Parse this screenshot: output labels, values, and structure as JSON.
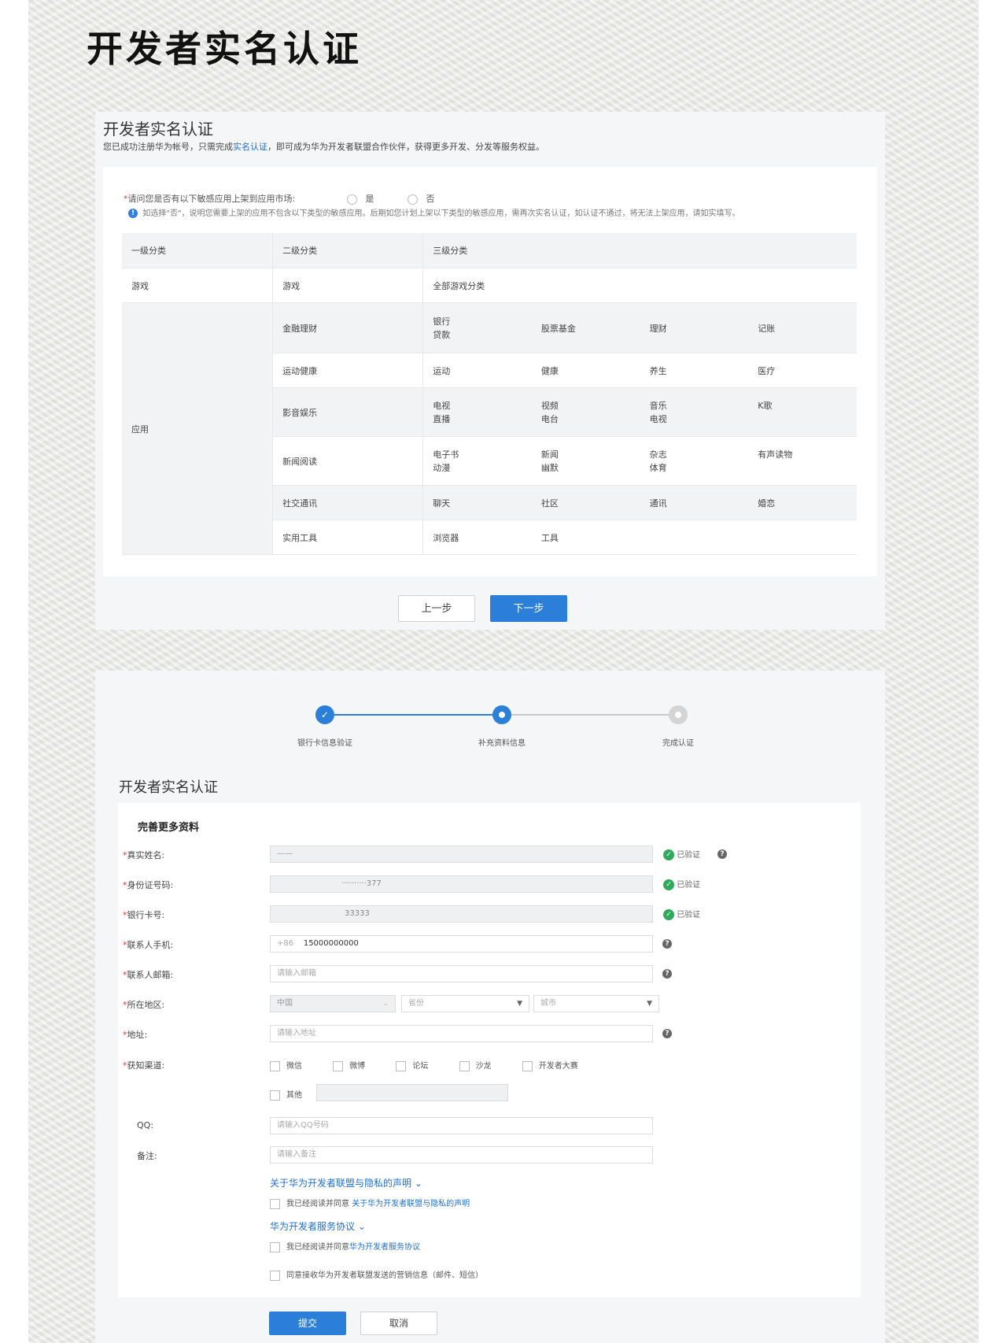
{
  "page_title": "开发者实名认证",
  "panel1": {
    "title": "开发者实名认证",
    "intro_before": "您已成功注册华为帐号，只需完成",
    "intro_link": "实名认证",
    "intro_after": "，即可成为华为开发者联盟合作伙伴，获得更多开发、分发等服务权益。",
    "question_required": "*",
    "question": "请问您是否有以下敏感应用上架到应用市场:",
    "option_yes": "是",
    "option_no": "否",
    "notice": "如选择\"否\"，说明您需要上架的应用不包含以下类型的敏感应用。后期如您计划上架以下类型的敏感应用，需再次实名认证，如认证不通过，将无法上架应用，请如实填写。",
    "table": {
      "headers": [
        "一级分类",
        "二级分类",
        "三级分类"
      ],
      "game_row": {
        "c1": "游戏",
        "c2": "游戏",
        "c3": "全部游戏分类"
      },
      "app_label": "应用",
      "app_rows": [
        {
          "name": "金融理财",
          "cells": [
            "银行\n贷款",
            "股票基金",
            "理财",
            "记账"
          ]
        },
        {
          "name": "运动健康",
          "cells": [
            "运动",
            "健康",
            "养生",
            "医疗"
          ]
        },
        {
          "name": "影音娱乐",
          "cells": [
            "电视\n直播",
            "视频\n电台",
            "音乐\n电视",
            "K歌"
          ]
        },
        {
          "name": "新闻阅读",
          "cells": [
            "电子书\n动漫",
            "新闻\n幽默",
            "杂志\n体育",
            "有声读物"
          ]
        },
        {
          "name": "社交通讯",
          "cells": [
            "聊天",
            "社区",
            "通讯",
            "婚恋"
          ]
        },
        {
          "name": "实用工具",
          "cells": [
            "浏览器",
            "工具",
            "",
            ""
          ]
        }
      ]
    },
    "prev_button": "上一步",
    "next_button": "下一步"
  },
  "panel2": {
    "steps": [
      {
        "label": "银行卡信息验证",
        "state": "done"
      },
      {
        "label": "补充资料信息",
        "state": "active"
      },
      {
        "label": "完成认证",
        "state": "pending"
      }
    ],
    "title": "开发者实名认证",
    "section_title": "完善更多资料",
    "required_mark": "*",
    "labels": {
      "name": "真实姓名:",
      "id": "身份证号码:",
      "bank": "银行卡号:",
      "phone": "联系人手机:",
      "email": "联系人邮箱:",
      "region": "所在地区:",
      "address": "地址:",
      "channel": "获知渠道:",
      "qq": "QQ:",
      "remark": "备注:"
    },
    "values": {
      "name": "——",
      "id": "··········377",
      "bank": "33333",
      "phone_prefix": "+86",
      "phone": "15000000000"
    },
    "placeholders": {
      "email": "请输入邮箱",
      "address": "请输入地址",
      "qq": "请输入QQ号码",
      "remark": "请输入备注"
    },
    "region": {
      "country": "中国",
      "province": "省份",
      "city": "城市"
    },
    "verified": "已验证",
    "channels": [
      "微信",
      "微博",
      "论坛",
      "沙龙",
      "开发者大赛"
    ],
    "channel_other": "其他",
    "privacy_link": "关于华为开发者联盟与隐私的声明",
    "privacy_agree": "我已经阅读并同意",
    "privacy_agree_link": "关于华为开发者联盟与隐私的声明",
    "service_link": "华为开发者服务协议",
    "service_agree": "我已经阅读并同意",
    "service_agree_link": "华为开发者服务协议",
    "marketing": "同意接收华为开发者联盟发送的营销信息（邮件、短信）",
    "submit_button": "提交",
    "cancel_button": "取消"
  },
  "colors": {
    "primary": "#2b7fd8",
    "success": "#2faa5a",
    "required": "#e03c3c"
  }
}
